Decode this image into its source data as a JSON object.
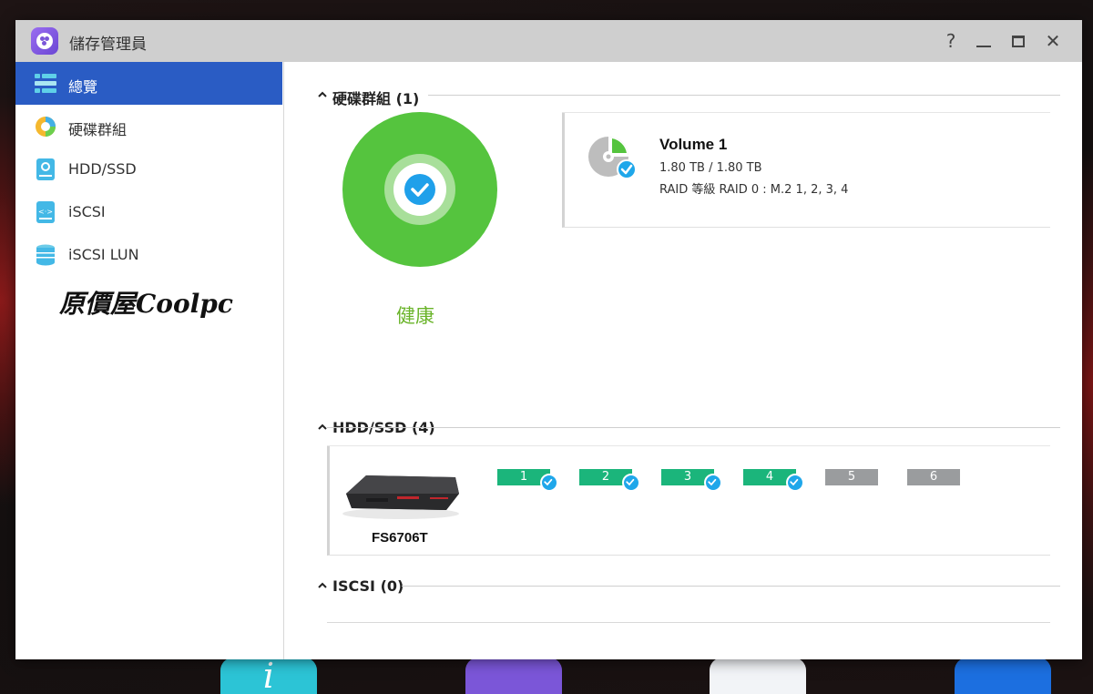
{
  "window": {
    "title": "儲存管理員"
  },
  "sidebar": {
    "items": [
      {
        "label": "總覽",
        "icon": "overview-icon",
        "active": true
      },
      {
        "label": "硬碟群組",
        "icon": "disk-group-icon",
        "active": false
      },
      {
        "label": "HDD/SSD",
        "icon": "hdd-icon",
        "active": false
      },
      {
        "label": "iSCSI",
        "icon": "iscsi-icon",
        "active": false
      },
      {
        "label": "iSCSI LUN",
        "icon": "iscsi-lun-icon",
        "active": false
      }
    ],
    "logo": "原價屋Coolpc"
  },
  "disk_group": {
    "title": "硬碟群組 (1)",
    "health": "健康",
    "volume": {
      "name": "Volume 1",
      "size": "1.80 TB / 1.80 TB",
      "raid": "RAID 等級 RAID 0 : M.2 1, 2, 3, 4"
    }
  },
  "hdd_ssd": {
    "title": "HDD/SSD (4)",
    "device_name": "FS6706T",
    "slots": [
      {
        "label": "1",
        "status": "ok"
      },
      {
        "label": "2",
        "status": "ok"
      },
      {
        "label": "3",
        "status": "ok"
      },
      {
        "label": "4",
        "status": "ok"
      },
      {
        "label": "5",
        "status": "empty"
      },
      {
        "label": "6",
        "status": "empty"
      }
    ]
  },
  "iscsi": {
    "title": "ISCSI (0)"
  },
  "colors": {
    "accent": "#2a5cc4",
    "healthy": "#55c43e",
    "slot_ok": "#1bb57b",
    "slot_empty": "#9a9c9e",
    "check": "#1fa0ea"
  }
}
